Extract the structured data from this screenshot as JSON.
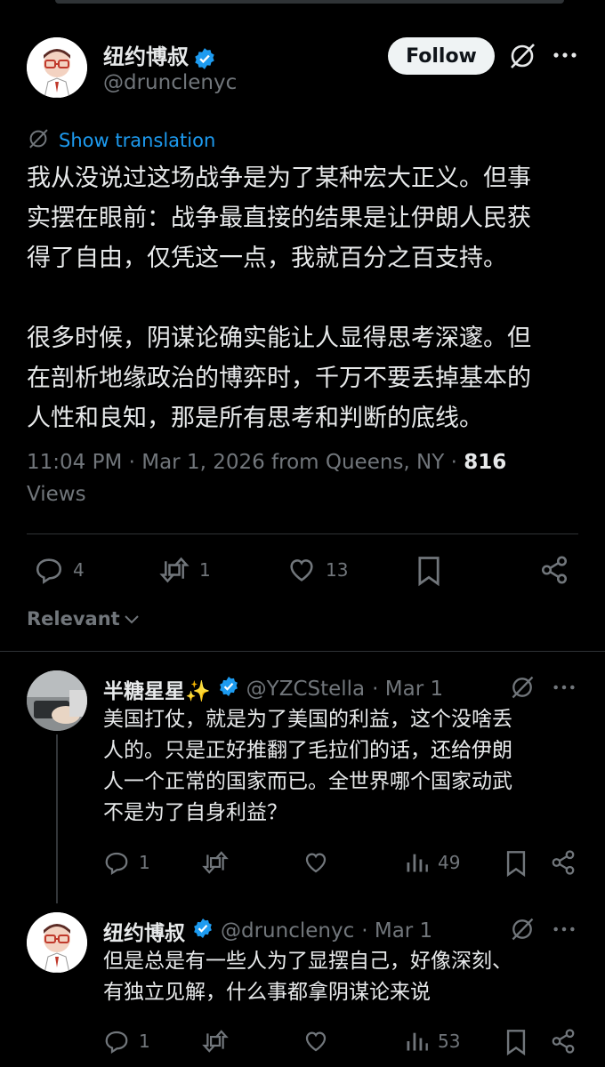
{
  "main_post": {
    "author_name": "纽约博叔",
    "handle": "@drunclenyc",
    "follow_label": "Follow",
    "translate_label": "Show translation",
    "paragraph1_lines": [
      "我从没说过这场战争是为了某种宏大正义。但事",
      "实摆在眼前：战争最直接的结果是让伊朗人民获",
      "得了自由，仅凭这一点，我就百分之百支持。"
    ],
    "paragraph2_lines": [
      "很多时候，阴谋论确实能让人显得思考深邃。但",
      "在剖析地缘政治的博弈时，千万不要丢掉基本的",
      "人性和良知，那是所有思考和判断的底线。"
    ],
    "timestamp": "11:04 PM · Mar 1, 2026 from Queens, NY · ",
    "views_count": "816",
    "views_label": "Views",
    "replies": "4",
    "reposts": "1",
    "likes": "13"
  },
  "sort_label": "Relevant",
  "replies": [
    {
      "author_name": "半糖星星✨",
      "handle": "@YZCStella",
      "date": "· Mar 1",
      "lines": [
        "美国打仗，就是为了美国的利益，这个没啥丢",
        "人的。只是正好推翻了毛拉们的话，还给伊朗",
        "人一个正常的国家而已。全世界哪个国家动武",
        "不是为了自身利益？"
      ],
      "replies": "1",
      "views": "49"
    },
    {
      "author_name": "纽约博叔",
      "handle": "@drunclenyc",
      "date": "· Mar 1",
      "lines": [
        "但是总是有一些人为了显摆自己，好像深刻、",
        "有独立见解，什么事都拿阴谋论来说"
      ],
      "replies": "1",
      "views": "53"
    }
  ],
  "colors": {
    "accent": "#1d9bf0",
    "muted": "#71767b",
    "text": "#e7e9ea",
    "bg": "#000000"
  }
}
